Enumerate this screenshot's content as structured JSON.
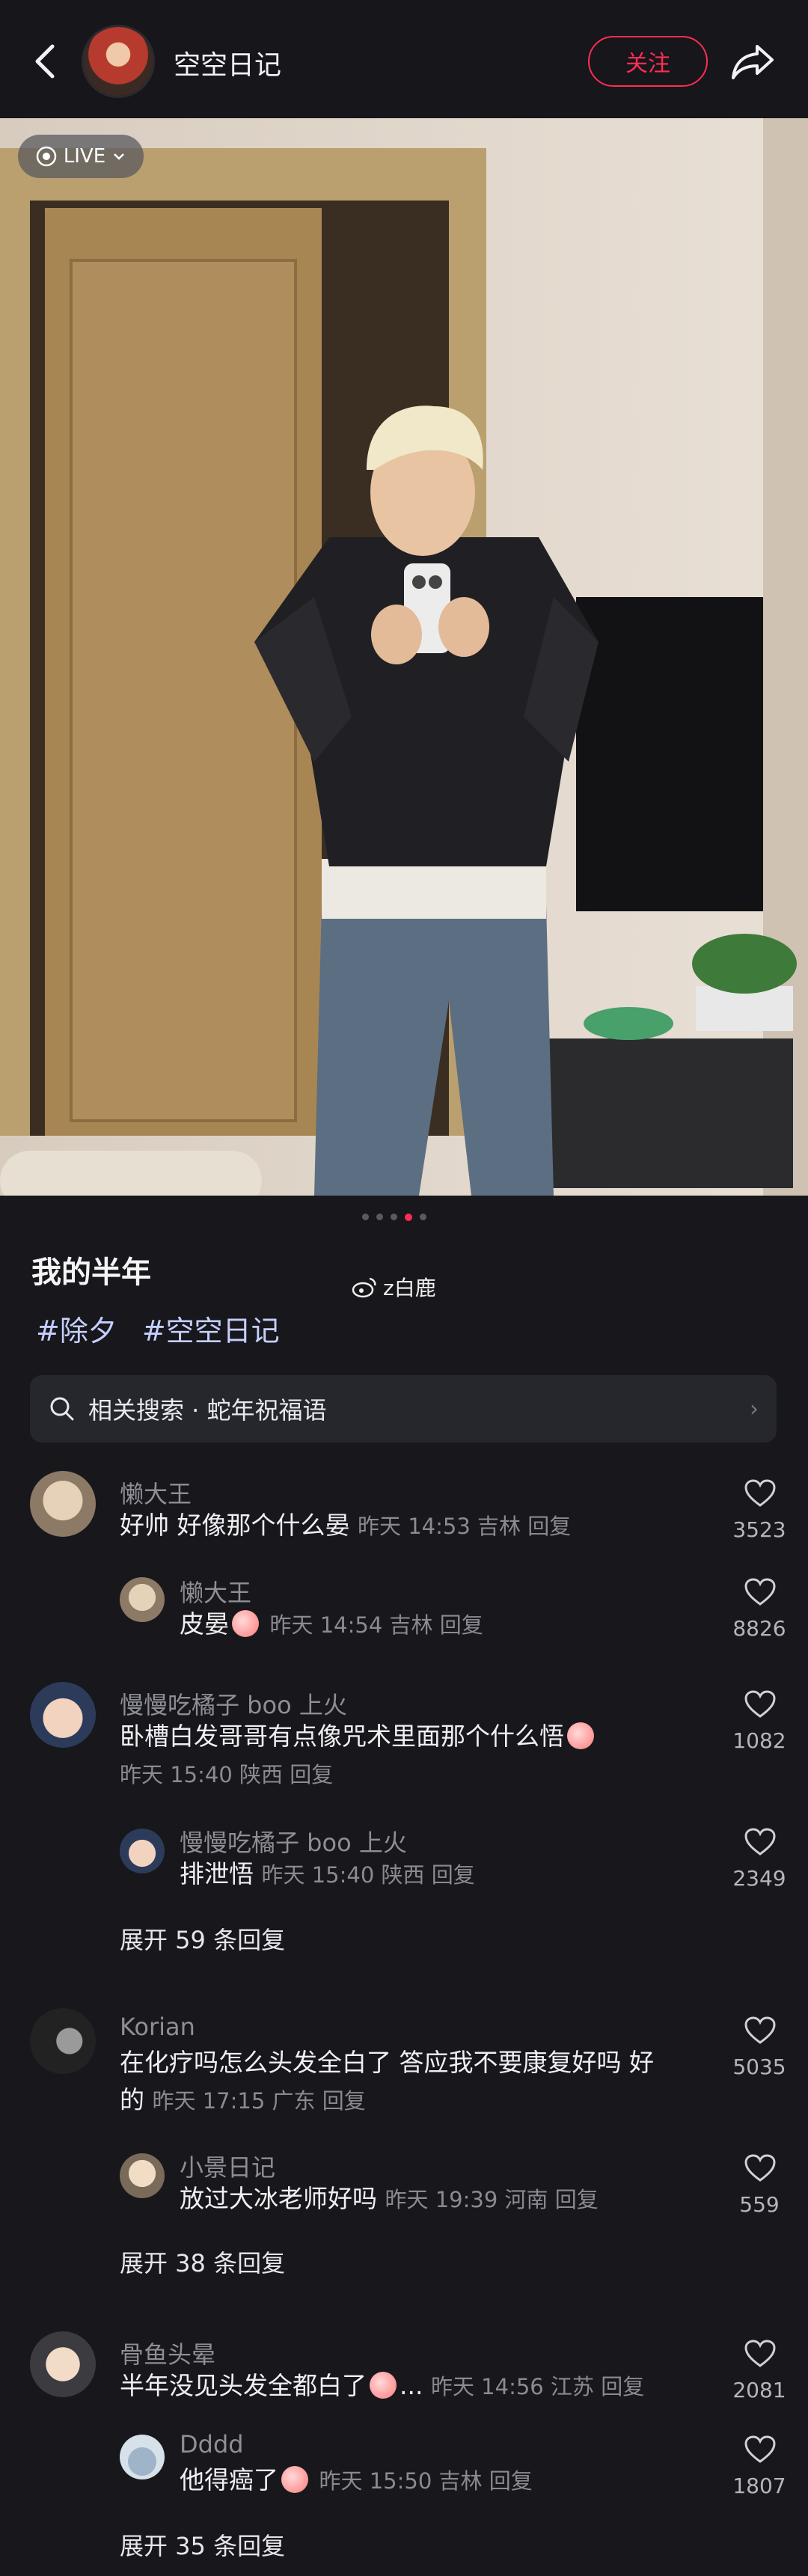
{
  "header": {
    "author": "空空日记",
    "follow_label": "关注"
  },
  "photo": {
    "live_label": "LIVE"
  },
  "post": {
    "title": "我的半年",
    "watermark": "z白鹿",
    "tags": [
      "#除夕",
      "#空空日记"
    ]
  },
  "related_search": {
    "label": "相关搜索 · 蛇年祝福语"
  },
  "comments": [
    {
      "name": "懒大王",
      "text": "好帅 好像那个什么晏",
      "meta": "昨天 14:53 吉林 回复",
      "likes": "3523",
      "replies": [
        {
          "name": "懒大王",
          "text": "皮晏",
          "meta": "昨天 14:54 吉林 回复",
          "likes": "8826"
        }
      ],
      "expand": ""
    },
    {
      "name": "慢慢吃橘子 boo 上火",
      "text": "卧槽白发哥哥有点像咒术里面那个什么悟",
      "meta": "昨天 15:40 陕西 回复",
      "likes": "1082",
      "replies": [
        {
          "name": "慢慢吃橘子 boo 上火",
          "text": "排泄悟",
          "meta": "昨天 15:40 陕西 回复",
          "likes": "2349"
        }
      ],
      "expand": "展开 59 条回复"
    },
    {
      "name": "Korian",
      "text": "在化疗吗怎么头发全白了 答应我不要康复好吗 好",
      "text2": "的",
      "meta": "昨天 17:15 广东 回复",
      "likes": "5035",
      "replies": [
        {
          "name": "小景日记",
          "text": "放过大冰老师好吗",
          "meta": "昨天 19:39 河南 回复",
          "likes": "559"
        }
      ],
      "expand": "展开 38 条回复"
    },
    {
      "name": "骨鱼头晕",
      "text": "半年没见头发全都白了",
      "meta": "昨天 14:56 江苏 回复",
      "likes": "2081",
      "replies": [
        {
          "name": "Dddd",
          "text": "他得癌了",
          "meta": "昨天 15:50 吉林 回复",
          "likes": "1807"
        }
      ],
      "expand": "展开 35 条回复"
    }
  ],
  "colors": {
    "accent": "#ff2d55",
    "background": "#17171c",
    "tag": "#c5cfff"
  }
}
